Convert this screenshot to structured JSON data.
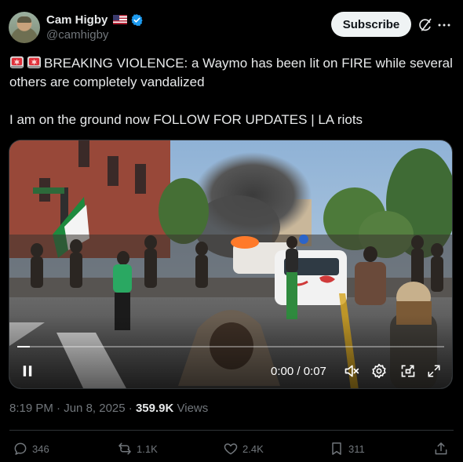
{
  "author": {
    "name": "Cam Higby",
    "handle": "@camhigby",
    "verified": true,
    "flag": "us-flag-icon"
  },
  "header": {
    "subscribe_label": "Subscribe",
    "icons": [
      "grok-icon",
      "more-icon"
    ]
  },
  "tweet": {
    "line1": "BREAKING VIOLENCE: a Waymo has been lit on FIRE while several others are completely vandalized",
    "line2": "I am on the ground now FOLLOW FOR UPDATES | LA riots",
    "leading_emoji": [
      "siren-icon",
      "siren-icon"
    ]
  },
  "video": {
    "timecode": "0:00 / 0:07",
    "progress": 0.03,
    "controls": [
      "pause-icon",
      "mute-icon",
      "settings-icon",
      "pip-icon",
      "fullscreen-icon"
    ]
  },
  "meta": {
    "time": "8:19 PM",
    "separator": " · ",
    "date": "Jun 8, 2025",
    "views_count": "359.9K",
    "views_label": "Views"
  },
  "actions": {
    "replies": "346",
    "reposts": "1.1K",
    "likes": "2.4K",
    "bookmarks": "311"
  },
  "colors": {
    "background": "#000000",
    "text_primary": "#e7e9ea",
    "text_secondary": "#71767b",
    "verified_blue": "#1d9bf0",
    "button_bg": "#eff3f4",
    "border": "#2f3336"
  }
}
